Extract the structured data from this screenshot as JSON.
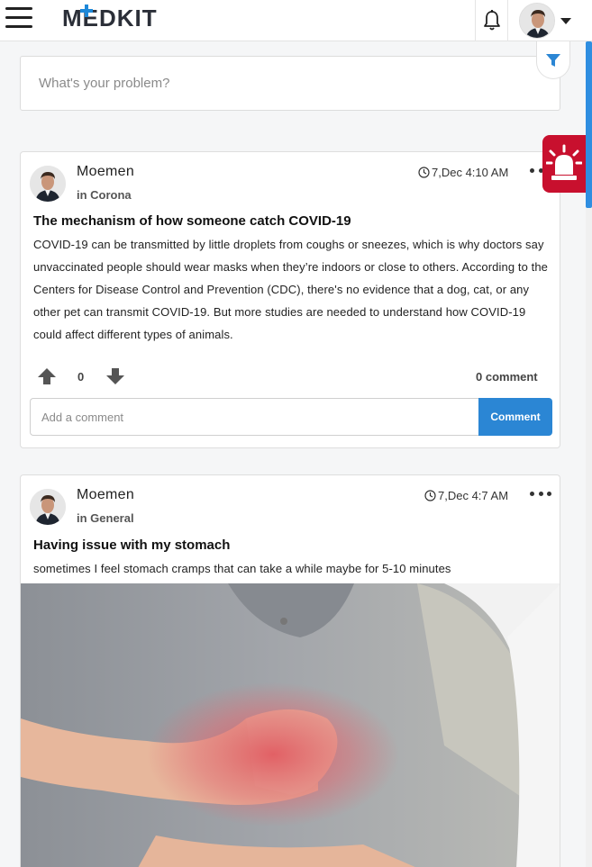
{
  "header": {
    "logo": "MEDKIT",
    "icons": {
      "menu": "hamburger-icon",
      "notifications": "bell-icon",
      "dropdown": "chevron-down-icon",
      "filter": "filter-icon",
      "alarm": "siren-icon"
    }
  },
  "search": {
    "placeholder": "What's your problem?"
  },
  "posts": [
    {
      "author": "Moemen",
      "category": "in Corona",
      "time": "7,Dec 4:10 AM",
      "title": "The mechanism of how someone catch COVID-19",
      "body": "COVID-19 can be transmitted by little droplets from coughs or sneezes, which is why doctors say unvaccinated people should wear masks when they’re indoors or close to others. According to the Centers for Disease Control and Prevention (CDC), there's no evidence that a dog, cat, or any other pet can transmit COVID-19. But more studies are needed to understand how COVID-19 could affect different types of animals.",
      "votes": "0",
      "comments": "0 comment",
      "comment_placeholder": "Add a comment",
      "comment_button": "Comment"
    },
    {
      "author": "Moemen",
      "category": "in General",
      "time": "7,Dec 4:7 AM",
      "title": "Having issue with my stomach",
      "body": "sometimes I feel stomach cramps that can take a while maybe for 5-10 minutes"
    }
  ],
  "colors": {
    "accent": "#2b86d4",
    "alarm": "#c8102e",
    "logo_cross": "#1e88d8"
  }
}
